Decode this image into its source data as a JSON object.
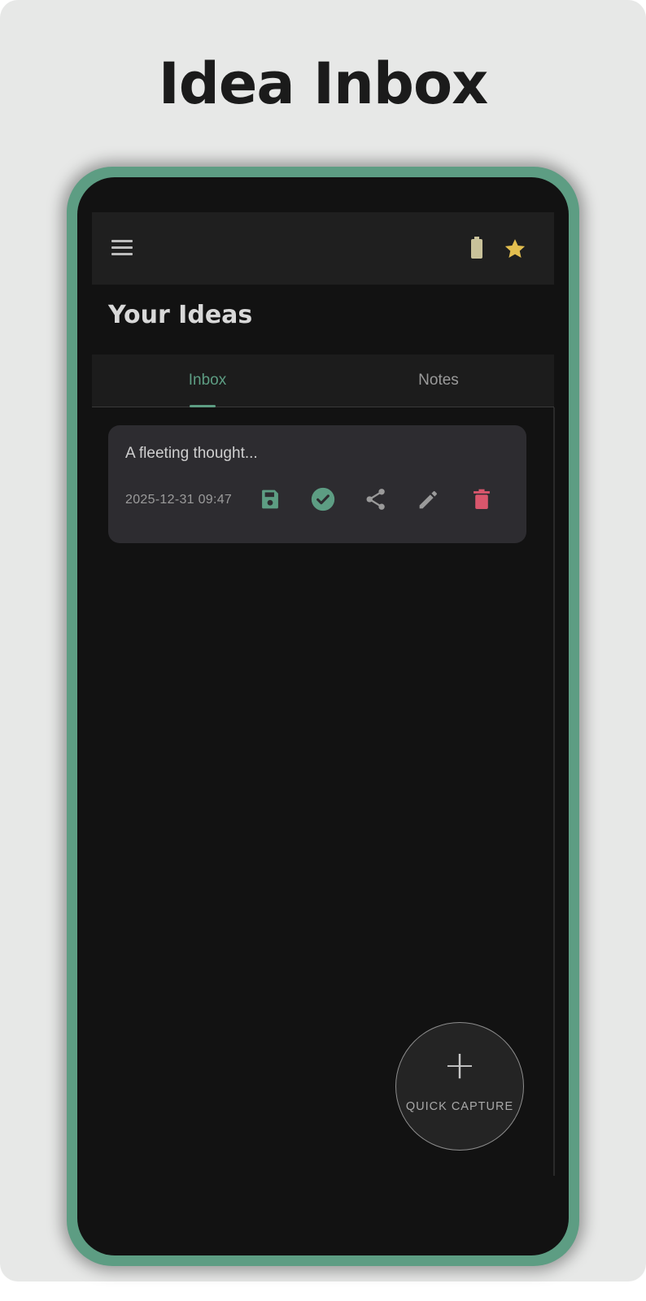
{
  "header": {
    "title": "Idea Inbox"
  },
  "app_bar": {
    "icons": {
      "menu": "menu-icon",
      "battery": "battery-icon",
      "favorite": "star-icon"
    },
    "colors": {
      "battery": "#c9c29a",
      "star": "#e2be4f"
    }
  },
  "page": {
    "title": "Your Ideas"
  },
  "tabs": [
    {
      "label": "Inbox",
      "active": true
    },
    {
      "label": "Notes",
      "active": false
    }
  ],
  "ideas": [
    {
      "text": "A fleeting thought...",
      "timestamp": "2025-12-31 09:47",
      "actions": [
        {
          "name": "save",
          "icon": "save-icon",
          "color": "#5d9d83"
        },
        {
          "name": "done",
          "icon": "check-circle-icon",
          "color": "#5d9d83"
        },
        {
          "name": "share",
          "icon": "share-icon",
          "color": "#9a9a9a"
        },
        {
          "name": "edit",
          "icon": "pencil-icon",
          "color": "#9a9a9a"
        },
        {
          "name": "delete",
          "icon": "trash-icon",
          "color": "#d9566c"
        }
      ]
    }
  ],
  "fab": {
    "icon": "+",
    "label": "QUICK CAPTURE"
  },
  "colors": {
    "accent": "#5d9d83",
    "danger": "#d9566c",
    "background": "#121212"
  }
}
